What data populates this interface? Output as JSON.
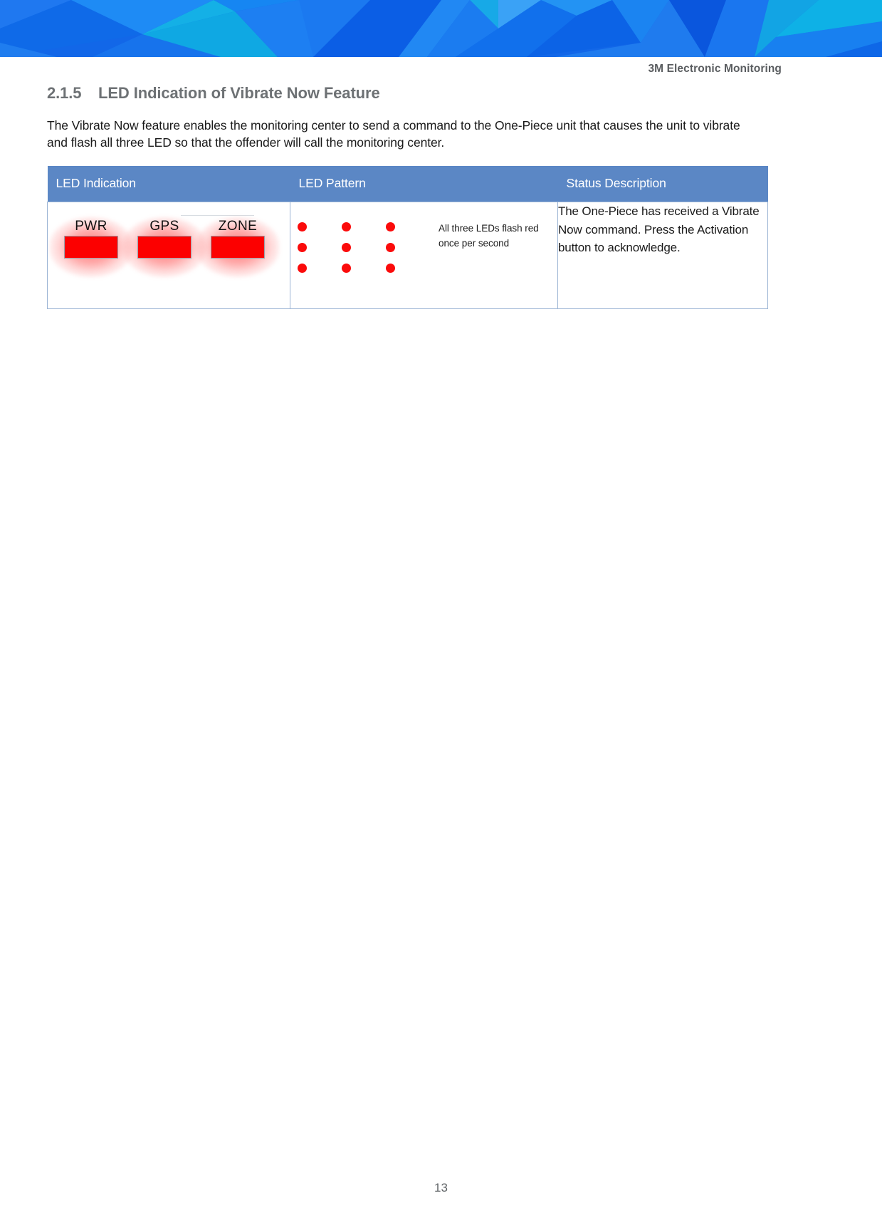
{
  "banner": {
    "name": "decorative-polygon-banner",
    "base_color": "#1267e8",
    "palette": [
      "#0a5fe0",
      "#1a73ee",
      "#0f86f0",
      "#17a6e8",
      "#0bb6e3",
      "#2f8df2",
      "#0d5ee2",
      "#1e9ae6",
      "#3aa0f5",
      "#0a4fd8"
    ]
  },
  "header": {
    "title": "3M Electronic Monitoring"
  },
  "section": {
    "number": "2.1.5",
    "title": "LED Indication of Vibrate Now Feature",
    "intro": "The Vibrate Now feature enables the monitoring center to send a command to the One-Piece unit that causes the unit to vibrate and flash all three LED so that the offender will call the monitoring center."
  },
  "table": {
    "columns": [
      {
        "key": "indication",
        "label": "LED Indication"
      },
      {
        "key": "pattern",
        "label": "LED Pattern"
      },
      {
        "key": "status",
        "label": "Status Description"
      }
    ],
    "header_bg": "#5b87c5",
    "border_color": "#9bb4d4",
    "rows": [
      {
        "indication": {
          "leds": [
            {
              "label": "PWR",
              "color": "#fc0000",
              "state": "on"
            },
            {
              "label": "GPS",
              "color": "#fc0000",
              "state": "on"
            },
            {
              "label": "ZONE",
              "color": "#fc0000",
              "state": "on"
            }
          ]
        },
        "pattern": {
          "dot_color": "#fb0b0b",
          "rows": 3,
          "columns": 3,
          "caption": "All three LEDs flash red once per second"
        },
        "status": "The One-Piece has received a Vibrate Now command. Press the Activation button to acknowledge."
      }
    ]
  },
  "footer": {
    "page_number": "13"
  }
}
